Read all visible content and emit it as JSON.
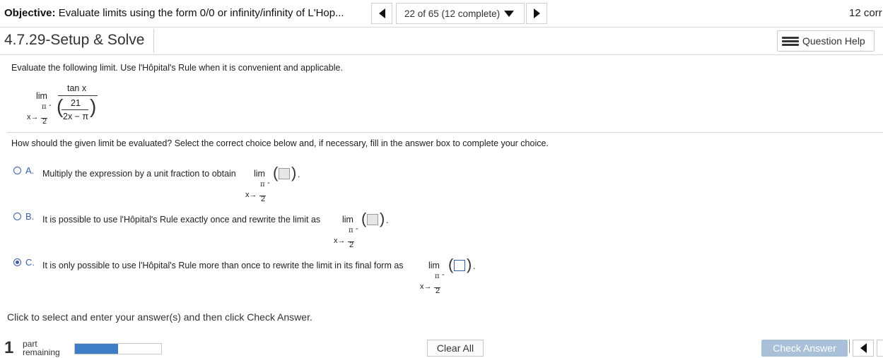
{
  "header": {
    "objective_label": "Objective:",
    "objective_text": "Evaluate limits using the form 0/0 or infinity/infinity of L'Hop...",
    "question_counter": "22 of 65 (12 complete)",
    "score_partial": "12 corr"
  },
  "question": {
    "title": "4.7.29-Setup & Solve",
    "help_label": "Question Help",
    "prompt": "Evaluate the following limit. Use l'Hôpital's Rule when it is convenient and applicable.",
    "limit": {
      "lim": "lim",
      "x_arrow": "x→",
      "pi": "π",
      "two": "2",
      "minus": "-",
      "numerator": "tan x",
      "inner_numerator": "21",
      "inner_denominator": "2x − π"
    },
    "instruction": "How should the given limit be evaluated? Select the correct choice below and, if necessary, fill in the answer box to complete your choice.",
    "options": [
      {
        "letter": "A.",
        "text": "Multiply the expression by a unit fraction to obtain",
        "selected": false
      },
      {
        "letter": "B.",
        "text": "It is possible to use l'Hôpital's Rule exactly once and rewrite the limit as",
        "selected": false
      },
      {
        "letter": "C.",
        "text": "It is only possible to use l'Hôpital's Rule more than once to rewrite the limit in its final form as",
        "selected": true
      }
    ],
    "period": "."
  },
  "footer": {
    "hint": "Click to select and enter your answer(s) and then click Check Answer.",
    "parts_number": "1",
    "parts_label": "part",
    "parts_label_2": "remaining",
    "progress_fraction": 0.5,
    "clear_all": "Clear All",
    "check_answer": "Check Answer"
  },
  "colors": {
    "accent": "#3b5ca8",
    "progress": "#3f7cc6",
    "check_button": "#a8c1d9"
  }
}
